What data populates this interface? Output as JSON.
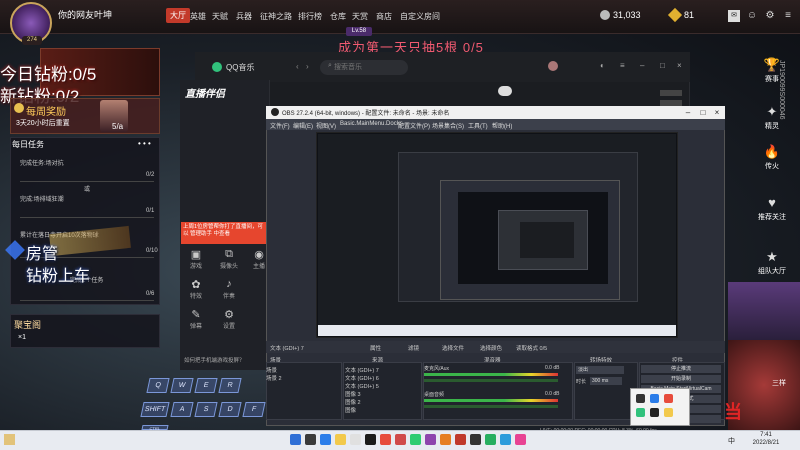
{
  "player": {
    "name": "你的网友叶坤",
    "level": "274",
    "level_badge": "Lv.58"
  },
  "nav": [
    {
      "label": "大厅",
      "active": true
    },
    {
      "label": "英雄"
    },
    {
      "label": "天赋"
    },
    {
      "label": "兵器"
    },
    {
      "label": "征神之路"
    },
    {
      "label": "排行榜"
    },
    {
      "label": "仓库"
    },
    {
      "label": "天赏"
    },
    {
      "label": "商店"
    },
    {
      "label": "自定义房间"
    }
  ],
  "currency": {
    "coins": "31,033",
    "gems": "81"
  },
  "overlay": {
    "daily_big": "今日钻粉:0/5",
    "diamond_big": "新钻粉:0/2",
    "fang_guan": "房管",
    "zuan_fen": "钻粉上车",
    "fly_text": "成为第一天只抽5根 0/5",
    "vertical_id": "JP190099S000046"
  },
  "weekly": {
    "title": "每周奖励",
    "time": "3天20小时后重置",
    "progress": "5/a"
  },
  "tasks": {
    "header": "每日任务",
    "more": "• • •",
    "items": [
      {
        "text": "完成任务:场对抗",
        "count": "0/2"
      },
      {
        "text": "完成:场排域狂潮",
        "count": "0/1"
      },
      {
        "text": "累计在落日寺开启10次落物球",
        "count": "0/10"
      },
      {
        "text": "完成1个任务",
        "count": "0/6"
      }
    ],
    "separator": "或"
  },
  "treasure": {
    "title": "聚宝阁",
    "count": "×1"
  },
  "keyboard": [
    "Q",
    "W",
    "E",
    "R",
    "A",
    "S",
    "D",
    "F",
    "SHIFT",
    "CTRL"
  ],
  "sidebar": [
    {
      "icon": "trophy-icon",
      "glyph": "🏆",
      "label": "赛事"
    },
    {
      "icon": "spark-icon",
      "glyph": "✦",
      "label": "精灵"
    },
    {
      "icon": "fire-icon",
      "glyph": "🔥",
      "label": "传火"
    },
    {
      "icon": "heart-icon",
      "glyph": "♥",
      "label": "推荐关注"
    },
    {
      "icon": "star-icon",
      "glyph": "★",
      "label": "组队大厅"
    }
  ],
  "right": {
    "sanxiang": "三样",
    "red_char": "当"
  },
  "qq": {
    "title": "QQ音乐",
    "search_placeholder": "搜索音乐"
  },
  "zb": {
    "title": "直播伴侣",
    "promo": "上周1位房管帮你打了直播间，可以 管理助手 中查看",
    "tools": [
      {
        "glyph": "▣",
        "label": "游戏"
      },
      {
        "glyph": "⧉",
        "label": "摄像头"
      },
      {
        "glyph": "◉",
        "label": "主播"
      },
      {
        "glyph": "✿",
        "label": "特效"
      },
      {
        "glyph": "♪",
        "label": "伴奏"
      },
      {
        "glyph": "✎",
        "label": "弹幕"
      },
      {
        "glyph": "⚙",
        "label": "设置"
      }
    ],
    "tip": "如何把手机端游戏投屏？"
  },
  "obs": {
    "title": "OBS 27.2.4 (64-bit, windows) - 配置文件: 未命名 - 场景: 未命名",
    "menus": [
      "文件(F)",
      "编辑(E)",
      "视图(V)",
      "Basic.MainMenu.Docks",
      "配置文件(P)",
      "场景集合(S)",
      "工具(T)",
      "帮助(H)"
    ],
    "toolbar": [
      "文本 (GDI+) 7",
      "属性",
      "滤镜",
      "选择文件",
      "选择颜色",
      "读取格式 0/5"
    ],
    "docks": [
      "场景",
      "来源",
      "混音器",
      "转场特效",
      "控件"
    ],
    "scenes": [
      "场景",
      "场景 2"
    ],
    "sources": [
      "文本 (GDI+) 7",
      "文本 (GDI+) 6",
      "文本 (GDI+) 5",
      "图像 3",
      "图像 2",
      "图像"
    ],
    "mixer": [
      {
        "label": "麦克风/Aux",
        "db": "0.0 dB"
      },
      {
        "label": "桌面音频",
        "db": "0.0 dB"
      }
    ],
    "transition": {
      "select": "淡出",
      "duration_label": "时长",
      "duration": "300 ms"
    },
    "controls": [
      "停止推流",
      "开始录制",
      "Basic.Main.StartVirtualCam",
      "工作室模式",
      "设置",
      "退出"
    ],
    "status": "LIVE: 00:00:00  REC: 00:00:00  CPU: 8.3%, 60.00 fps"
  },
  "taskbar": {
    "time": "7:41",
    "date": "2022/8/21",
    "lang": "中",
    "icons": [
      "#2f6fd6",
      "#3a3a3a",
      "#2b7de9",
      "#f2c94c",
      "#e0e0e0",
      "#1a1a1a",
      "#e74c3c",
      "#d04a4a",
      "#2ecc71",
      "#8e44ad",
      "#e67e22",
      "#c0392b",
      "#333333",
      "#27ae60",
      "#2d9cdb",
      "#e84393"
    ]
  },
  "colors": {
    "accent": "#c33a2a",
    "gold": "#ffcb5a",
    "qq_green": "#31c27c",
    "promo": "#e6462e"
  }
}
